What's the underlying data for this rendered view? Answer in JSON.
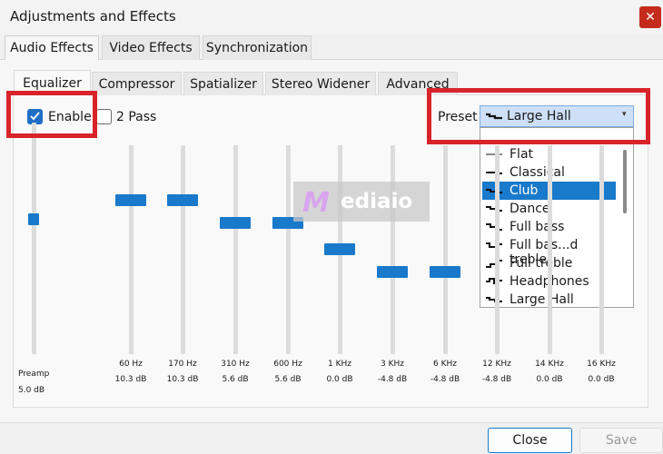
{
  "window": {
    "title": "Adjustments and Effects",
    "close_glyph": "✕"
  },
  "main_tabs": [
    {
      "label": "Audio Effects",
      "active": true
    },
    {
      "label": "Video Effects",
      "active": false
    },
    {
      "label": "Synchronization",
      "active": false
    }
  ],
  "sub_tabs": [
    {
      "label": "Equalizer",
      "active": true
    },
    {
      "label": "Compressor",
      "active": false
    },
    {
      "label": "Spatializer",
      "active": false
    },
    {
      "label": "Stereo Widener",
      "active": false
    },
    {
      "label": "Advanced",
      "active": false
    }
  ],
  "options": {
    "enable_label": "Enable",
    "enable_checked": true,
    "two_pass_label": "2 Pass",
    "two_pass_checked": false
  },
  "preset": {
    "label": "Preset",
    "selected": "Large Hall",
    "arrow": "▾",
    "items": [
      "Flat",
      "Classical",
      "Club",
      "Dance",
      "Full bass",
      "Full bas...d treble",
      "Full treble",
      "Headphones",
      "Large Hall"
    ],
    "highlighted": "Club"
  },
  "bands": [
    {
      "freq": "Preamp",
      "value": "5.0 dB",
      "db": 5.0
    },
    {
      "freq": "60 Hz",
      "value": "10.3 dB",
      "db": 10.3
    },
    {
      "freq": "170 Hz",
      "value": "10.3 dB",
      "db": 10.3
    },
    {
      "freq": "310 Hz",
      "value": "5.6 dB",
      "db": 5.6
    },
    {
      "freq": "600 Hz",
      "value": "5.6 dB",
      "db": 5.6
    },
    {
      "freq": "1 KHz",
      "value": "0.0 dB",
      "db": 0.0
    },
    {
      "freq": "3 KHz",
      "value": "-4.8 dB",
      "db": -4.8
    },
    {
      "freq": "6 KHz",
      "value": "-4.8 dB",
      "db": -4.8
    },
    {
      "freq": "12 KHz",
      "value": "-4.8 dB",
      "db": -4.8
    },
    {
      "freq": "14 KHz",
      "value": "0.0 dB",
      "db": 0.0
    },
    {
      "freq": "16 KHz",
      "value": "0.0 dB",
      "db": 0.0
    }
  ],
  "watermark": {
    "logo": "M",
    "text": "ediaio"
  },
  "buttons": {
    "close": "Close",
    "save": "Save"
  },
  "colors": {
    "accent": "#1979ca",
    "highlight_box": "#d9232a"
  }
}
